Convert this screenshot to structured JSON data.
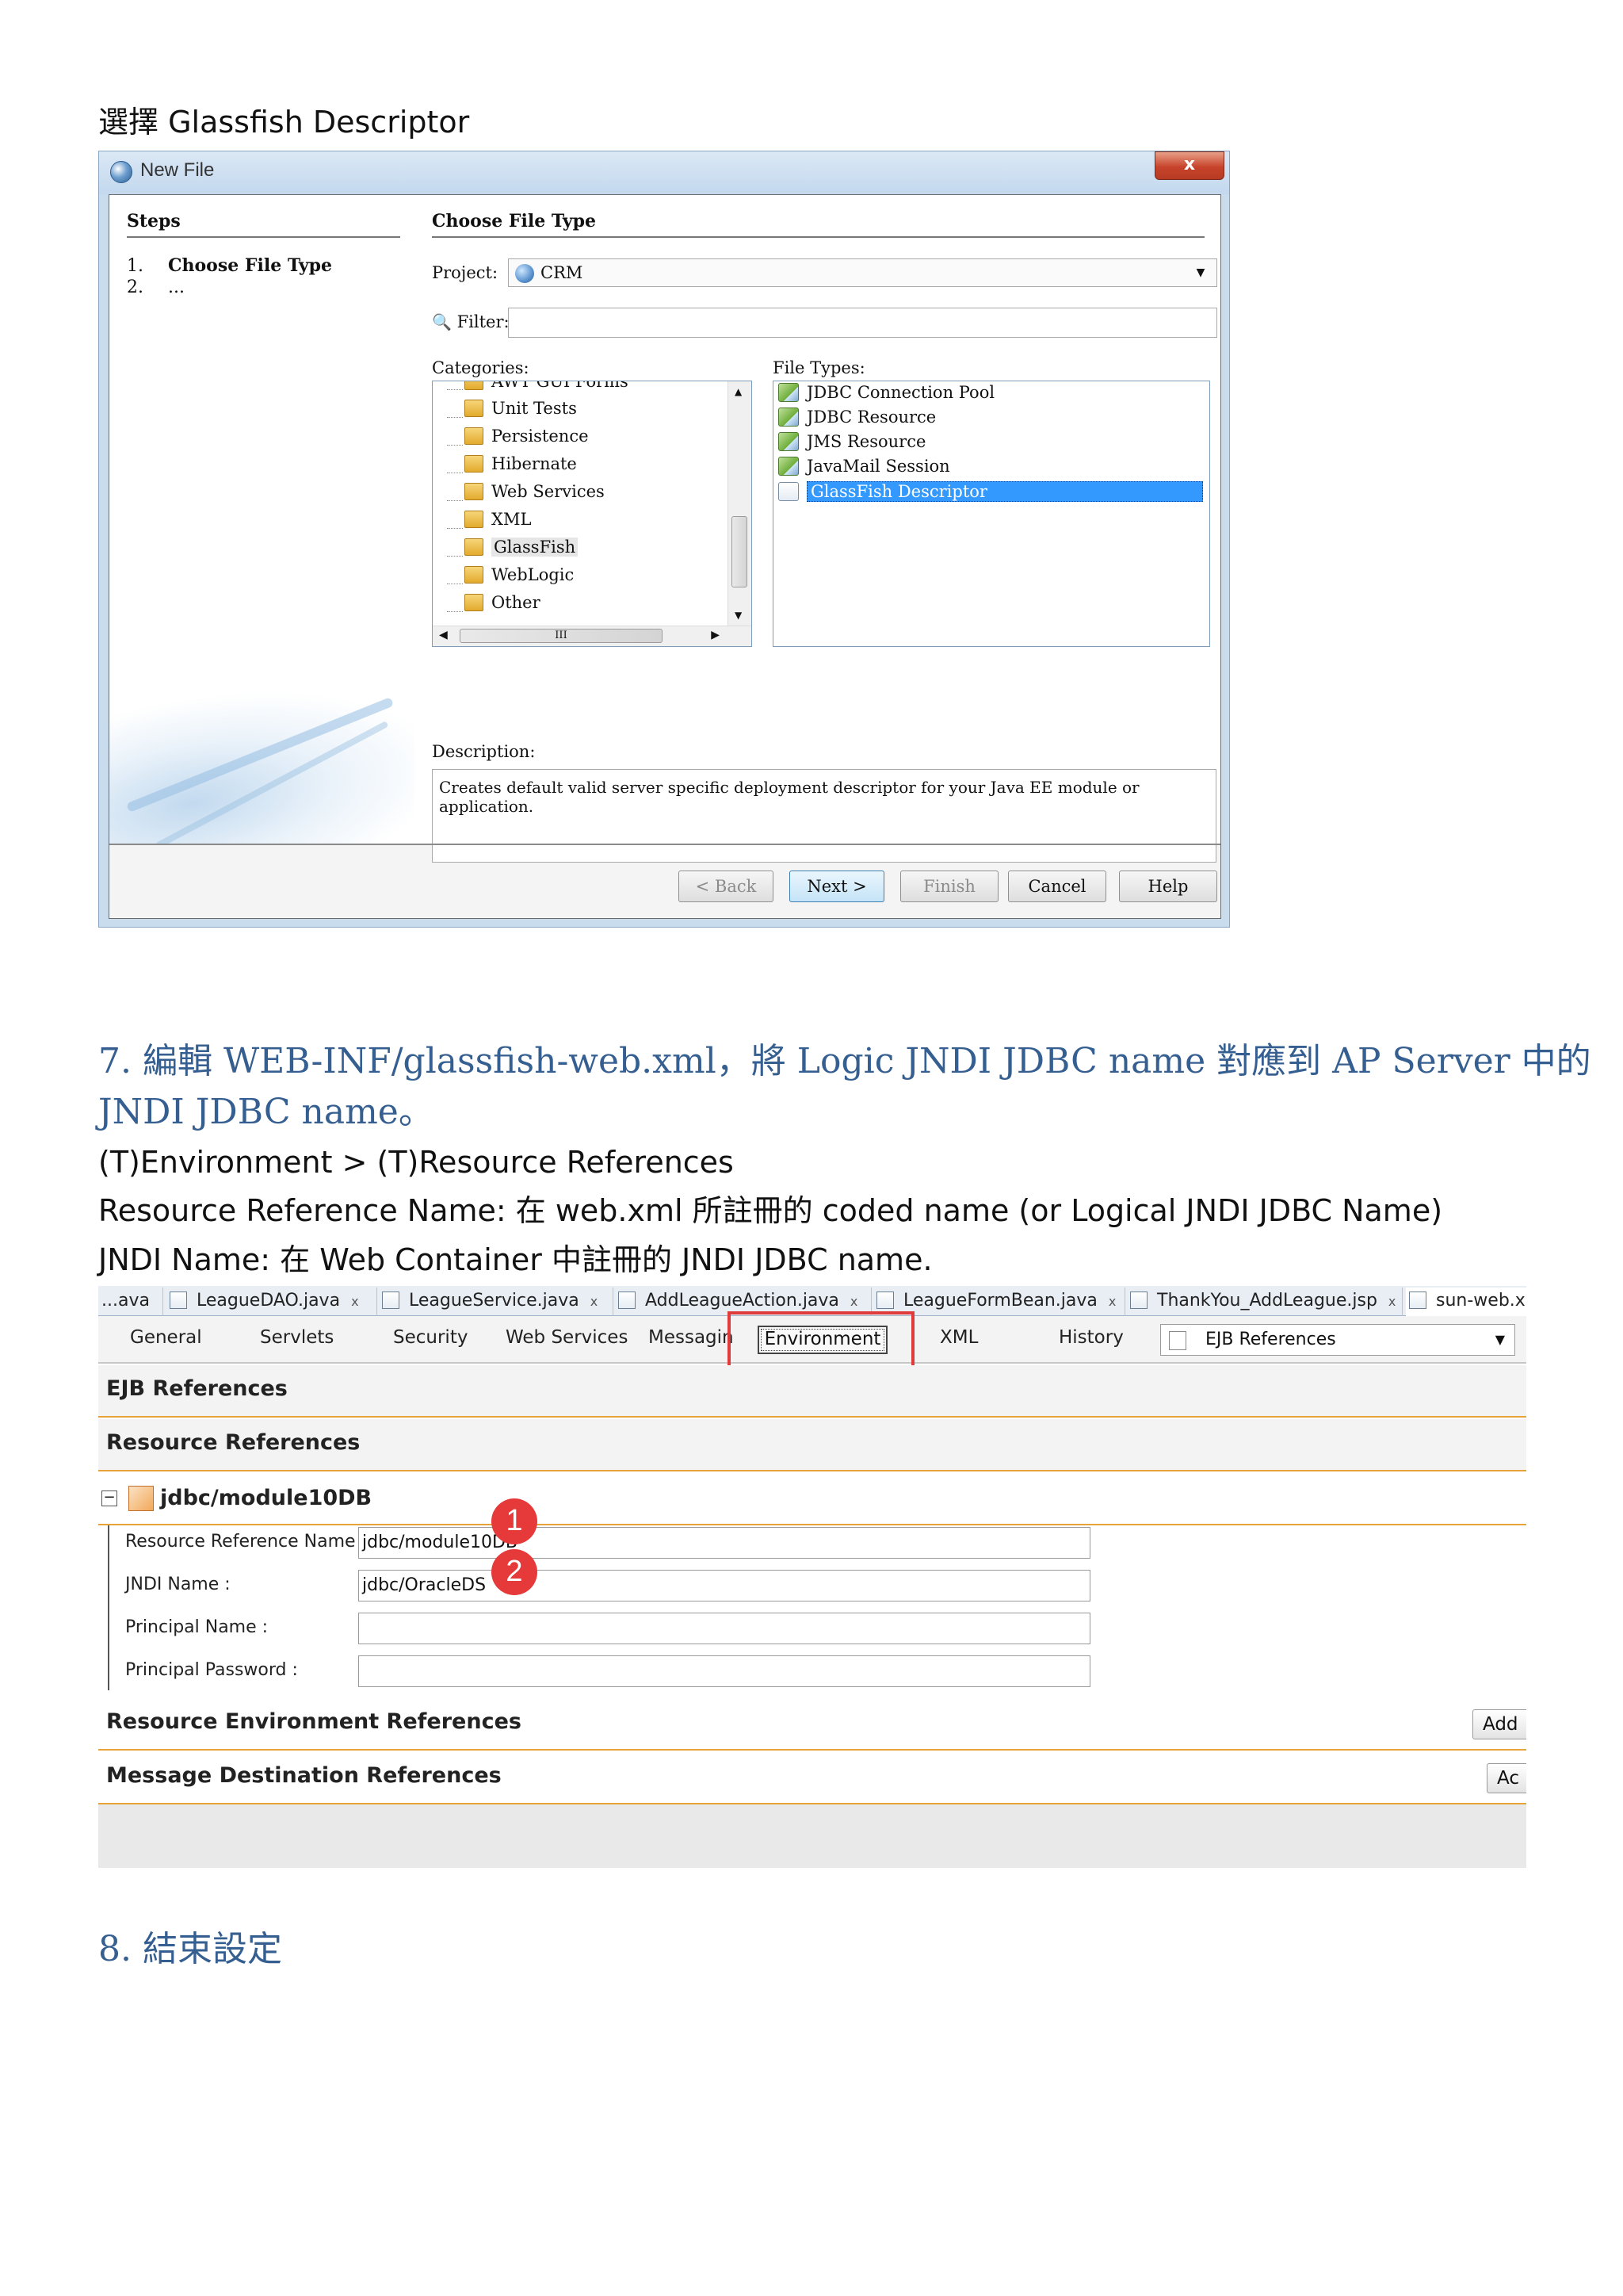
{
  "doc": {
    "caption_select": "選擇  Glassfish Descriptor",
    "step7_heading_line1": "7.  編輯  WEB-INF/glassfish-web.xml，將  Logic JNDI JDBC name  對應到  AP Server  中的",
    "step7_heading_line2": "JNDI JDBC name。",
    "line_env": "(T)Environment > (T)Resource References",
    "line_resref": "Resource Reference Name:  在  web.xml  所註冊的  coded name (or Logical JNDI JDBC Name)",
    "line_jndi": "JNDI Name:  在  Web Container  中註冊的  JNDI JDBC name.",
    "step8_heading": "8.  結束設定"
  },
  "dialog": {
    "title": "New File",
    "close_label": "x",
    "steps_title": "Steps",
    "steps": [
      {
        "num": "1.",
        "label": "Choose File Type"
      },
      {
        "num": "2.",
        "label": "..."
      }
    ],
    "section_title": "Choose File Type",
    "project_label": "Project:",
    "project_value": "CRM",
    "filter_label": "Filter:",
    "filter_value": "",
    "categories_label": "Categories:",
    "categories": [
      "AWT GUI Forms",
      "Unit Tests",
      "Persistence",
      "Hibernate",
      "Web Services",
      "XML",
      "GlassFish",
      "WebLogic",
      "Other"
    ],
    "selected_category": "GlassFish",
    "filetypes_label": "File Types:",
    "file_types": [
      "JDBC Connection Pool",
      "JDBC Resource",
      "JMS Resource",
      "JavaMail Session",
      "GlassFish Descriptor"
    ],
    "selected_file_type": "GlassFish Descriptor",
    "description_label": "Description:",
    "description": "Creates default valid server specific deployment descriptor for your Java EE module or application.",
    "buttons": {
      "back": "< Back",
      "next": "Next >",
      "finish": "Finish",
      "cancel": "Cancel",
      "help": "Help"
    },
    "hscroll_mark": "III"
  },
  "editor": {
    "file_tabs": [
      "...ava",
      "LeagueDAO.java",
      "LeagueService.java",
      "AddLeagueAction.java",
      "LeagueFormBean.java",
      "ThankYou_AddLeague.jsp",
      "sun-web.xr"
    ],
    "tab_close": "x",
    "nav": [
      "General",
      "Servlets",
      "Security",
      "Web Services",
      "Messaging",
      "Environment",
      "XML",
      "History"
    ],
    "active_nav": "Environment",
    "ref_combo": "EJB References",
    "sections": {
      "ejb": "EJB References",
      "resource": "Resource References",
      "resource_env": "Resource Environment References",
      "message_dest": "Message Destination References"
    },
    "add_label_1": "Add",
    "add_label_2": "Ac",
    "node_title": "jdbc/module10DB",
    "collapse_symbol": "−",
    "fields": [
      {
        "label": "Resource Reference Name :",
        "value": "jdbc/module10DB"
      },
      {
        "label": "JNDI Name :",
        "value": "jdbc/OracleDS"
      },
      {
        "label": "Principal Name :",
        "value": ""
      },
      {
        "label": "Principal Password :",
        "value": ""
      }
    ],
    "badges": [
      "1",
      "2"
    ]
  },
  "colors": {
    "heading_blue": "#365f91",
    "highlight_red": "#e03b3b",
    "section_rule_orange": "#e8a23a",
    "selection_blue": "#3399ff"
  }
}
